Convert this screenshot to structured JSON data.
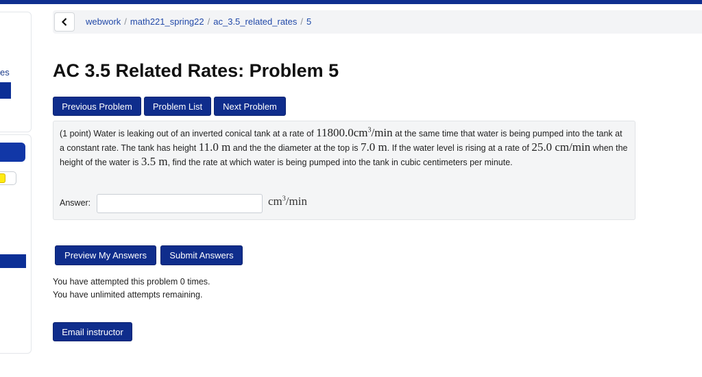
{
  "sidebar": {
    "partial_text": "es"
  },
  "breadcrumb": {
    "items": [
      "webwork",
      "math221_spring22",
      "ac_3.5_related_rates",
      "5"
    ]
  },
  "page_title": "AC 3.5 Related Rates: Problem 5",
  "nav_buttons": {
    "previous": "Previous Problem",
    "list": "Problem List",
    "next": "Next Problem"
  },
  "problem": {
    "points": "(1 point)",
    "t1": "Water is leaking out of an inverted conical tank at a rate of",
    "rate_leak": "11800.0",
    "t2": "at the same time that water is being pumped into the tank at a constant rate. The tank has height",
    "height": "11.0",
    "t3": "and the the diameter at the top is",
    "diameter": "7.0",
    "t4": "If the water level is rising at a rate of",
    "rate_rise": "25.0",
    "t5": "when the height of the water is",
    "water_height": "3.5",
    "t6": ", find the rate at which water is being pumped into the tank in cubic centimeters per minute.",
    "unit_cm": "cm",
    "unit_per_min": "/min",
    "unit_m": "m",
    "unit_cm_min": "cm/min",
    "cube": "3"
  },
  "answer": {
    "label": "Answer:",
    "value": "",
    "placeholder": "",
    "unit_base": "cm",
    "unit_exp": "3",
    "unit_tail": "/min"
  },
  "submit_buttons": {
    "preview": "Preview My Answers",
    "submit": "Submit Answers"
  },
  "status": {
    "attempts": "You have attempted this problem 0 times.",
    "remaining": "You have unlimited attempts remaining."
  },
  "email_button": "Email instructor",
  "colors": {
    "primary": "#0f2d8c",
    "link": "#2249a8",
    "panel_bg": "#f4f5f6"
  }
}
